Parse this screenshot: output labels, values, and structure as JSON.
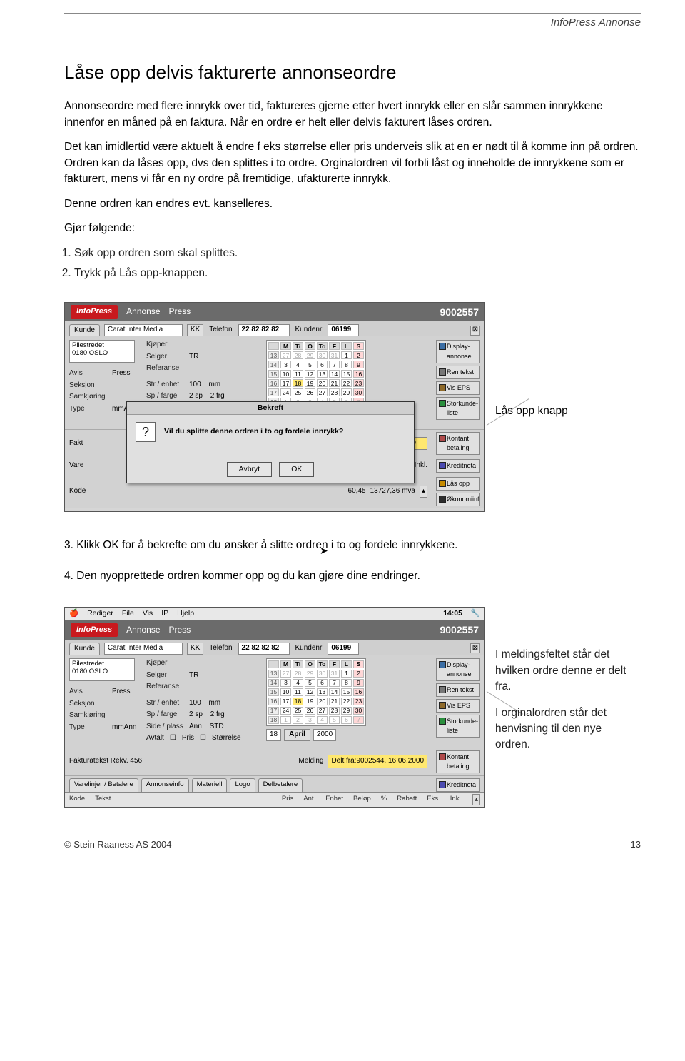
{
  "header": {
    "label": "InfoPress Annonse"
  },
  "title": "Låse opp delvis fakturerte annonseordre",
  "para1": "Annonseordre med flere innrykk over tid, faktureres gjerne etter hvert innrykk eller en slår sammen innrykkene innenfor en måned på en faktura. Når en ordre er helt eller delvis fakturert låses ordren.",
  "para2": "Det kan imidlertid være aktuelt å endre f eks størrelse eller pris underveis slik at en er nødt til å komme inn på ordren. Ordren kan da låses opp, dvs den splittes i to ordre. Orginalordren vil forbli låst og inneholde de innrykkene som er fakturert, mens vi får en ny ordre på fremtidige, ufakturerte innrykk.",
  "para3": "Denne ordren kan endres evt. kanselleres.",
  "para4": "Gjør følgende:",
  "li1": "Søk opp ordren som skal splittes.",
  "li2": "Trykk på Lås opp-knappen.",
  "annot_lasopp": "Lås opp knapp",
  "para5": "3.  Klikk OK for å bekrefte om du ønsker å slitte ordren i to og fordele innrykkene.",
  "para6": "4.  Den nyopprettede ordren kommer opp og du kan gjøre dine endringer.",
  "annot2a": "I meldingsfeltet står det hvilken ordre denne er delt fra.",
  "annot2b": "I orginalordren står det henvisning til den nye ordren.",
  "footer": {
    "copyright": "© Stein Raaness AS 2004",
    "page": "13"
  },
  "app": {
    "brand": "InfoPress",
    "section1": "Annonse",
    "section2": "Press",
    "orderno": "9002557",
    "menubar": {
      "items": [
        "Rediger",
        "File",
        "Vis",
        "IP",
        "Hjelp"
      ],
      "time": "14:05"
    },
    "tabs": {
      "kunde_label": "Kunde",
      "kunde_val": "Carat Inter Media",
      "kk": "KK",
      "telefon_label": "Telefon",
      "telefon_val": "22 82 82 82",
      "kundenr_label": "Kundenr",
      "kundenr_val": "06199"
    },
    "address": {
      "line1": "Pilestredet",
      "line2": "0180 OSLO"
    },
    "mid": {
      "kjoper": "Kjøper",
      "selger_k": "Selger",
      "selger_v": "TR",
      "referanse": "Referanse",
      "str_k": "Str / enhet",
      "str_v1": "100",
      "str_v2": "mm",
      "sp_k": "Sp / farge",
      "sp_v1": "2 sp",
      "sp_v2": "2 frg",
      "side_k": "Side / plass",
      "ann_k": "Ann",
      "ann_v": "STD",
      "avtalt": "Avtalt",
      "pris": "Pris",
      "storrelse": "Størrelse"
    },
    "leftcol": {
      "avis_k": "Avis",
      "avis_v": "Press",
      "seksjon": "Seksjon",
      "samkj": "Samkjøring",
      "type_k": "Type",
      "type_v": "mmAnn"
    },
    "calendar": {
      "dow": [
        "M",
        "Ti",
        "O",
        "To",
        "F",
        "L",
        "S"
      ],
      "rows": [
        [
          "13",
          "27",
          "28",
          "29",
          "30",
          "31",
          "1",
          "2"
        ],
        [
          "14",
          "3",
          "4",
          "5",
          "6",
          "7",
          "8",
          "9"
        ],
        [
          "15",
          "10",
          "11",
          "12",
          "13",
          "14",
          "15",
          "16"
        ],
        [
          "16",
          "17",
          "18",
          "19",
          "20",
          "21",
          "22",
          "23"
        ],
        [
          "17",
          "24",
          "25",
          "26",
          "27",
          "28",
          "29",
          "30"
        ],
        [
          "18",
          "1",
          "2",
          "3",
          "4",
          "5",
          "6",
          "7"
        ]
      ],
      "day": "18",
      "month": "April",
      "year": "2000"
    },
    "rbtns": {
      "display": "Display-annonse",
      "ren": "Ren tekst",
      "eps": "Vis EPS",
      "stork": "Storkunde-liste",
      "kontant": "Kontant betaling",
      "kredit": "Kreditnota",
      "lasopp": "Lås opp",
      "okonomi": "Økonomiinf."
    },
    "dialog": {
      "title": "Bekreft",
      "question": "Vil du splitte denne ordren i to og fordele innrykk?",
      "cancel": "Avbryt",
      "ok": "OK"
    },
    "msg1": {
      "fakt": "Fakt",
      "fra_label": "fra:",
      "fra_val": "fra:9002544, 16.06.2000",
      "vare": "Vare",
      "kode": "Kode",
      "eks_k": "Eks.",
      "eks_v": "60,45",
      "inkl_k": "Inkl.",
      "inkl_v": "13727,36 mva"
    },
    "msg2": {
      "faktekst": "Fakturatekst  Rekv. 456",
      "melding_k": "Melding",
      "melding_v": "Delt fra:9002544, 16.06.2000"
    },
    "subtabs": [
      "Varelinjer / Betalere",
      "Annonseinfo",
      "Materiell",
      "Logo",
      "Delbetalere"
    ],
    "tblhead": [
      "Kode",
      "Tekst",
      "Pris",
      "Ant.",
      "Enhet",
      "Beløp",
      "%",
      "Rabatt",
      "Eks.",
      "Inkl."
    ]
  }
}
